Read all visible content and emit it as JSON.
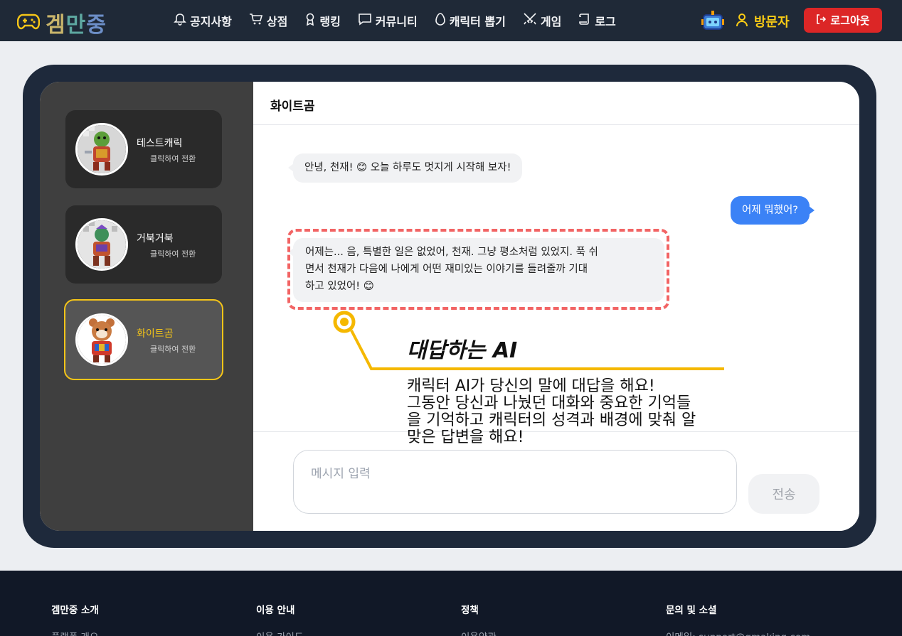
{
  "header": {
    "logo_text_1": "겜",
    "logo_text_2": "만",
    "logo_text_3": "중",
    "nav": [
      {
        "label": "공지사항",
        "icon": "bell-icon"
      },
      {
        "label": "상점",
        "icon": "cart-icon"
      },
      {
        "label": "랭킹",
        "icon": "medal-icon"
      },
      {
        "label": "커뮤니티",
        "icon": "chat-icon"
      },
      {
        "label": "캐릭터 뽑기",
        "icon": "egg-icon"
      },
      {
        "label": "게임",
        "icon": "swords-icon"
      },
      {
        "label": "로그",
        "icon": "scroll-icon"
      }
    ],
    "user_name": "방문자",
    "logout_label": "로그아웃"
  },
  "sidebar": {
    "characters": [
      {
        "name": "테스트캐릭",
        "hint": "클릭하여 전환",
        "active": false
      },
      {
        "name": "거북거북",
        "hint": "클릭하여 전환",
        "active": false
      },
      {
        "name": "화이트곰",
        "hint": "클릭하여 전환",
        "active": true
      }
    ]
  },
  "chat": {
    "title": "화이트곰",
    "messages": [
      {
        "from": "bot",
        "text": "안녕, 천재! 😊 오늘 하루도 멋지게 시작해 보자!"
      },
      {
        "from": "user",
        "text": "어제 뭐했어?"
      },
      {
        "from": "bot",
        "lines": [
          "어제는... 음, 특별한 일은 없었어, 천재. 그냥 평소처럼 있었지. 푹 쉬",
          "면서 천재가 다음에 나에게 어떤 재미있는 이야기를 들려줄까 기대",
          "하고 있었어! 😊"
        ]
      }
    ],
    "input_placeholder": "메시지 입력",
    "send_label": "전송"
  },
  "annotation": {
    "title": "대답하는 AI",
    "lines": [
      "캐릭터 AI가 당신의 말에 대답을 해요!",
      "그동안 당신과 나눴던 대화와 중요한 기억들",
      "을 기억하고 캐릭터의 성격과 배경에 맞춰 알",
      "맞은 답변을 해요!"
    ],
    "accent_color": "#f5b800",
    "highlight_color": "#f26464"
  },
  "footer": {
    "columns": [
      {
        "heading": "겜만중 소개",
        "link": "플랫폼 개요"
      },
      {
        "heading": "이용 안내",
        "link": "이용 가이드"
      },
      {
        "heading": "정책",
        "link": "이용약관"
      },
      {
        "heading": "문의 및 소셜",
        "link": "이메일: support@gmaking.com"
      }
    ]
  },
  "colors": {
    "topbar": "#1f2937",
    "user_accent": "#facc15",
    "logout": "#dc2626",
    "user_bubble": "#3b82f6"
  }
}
